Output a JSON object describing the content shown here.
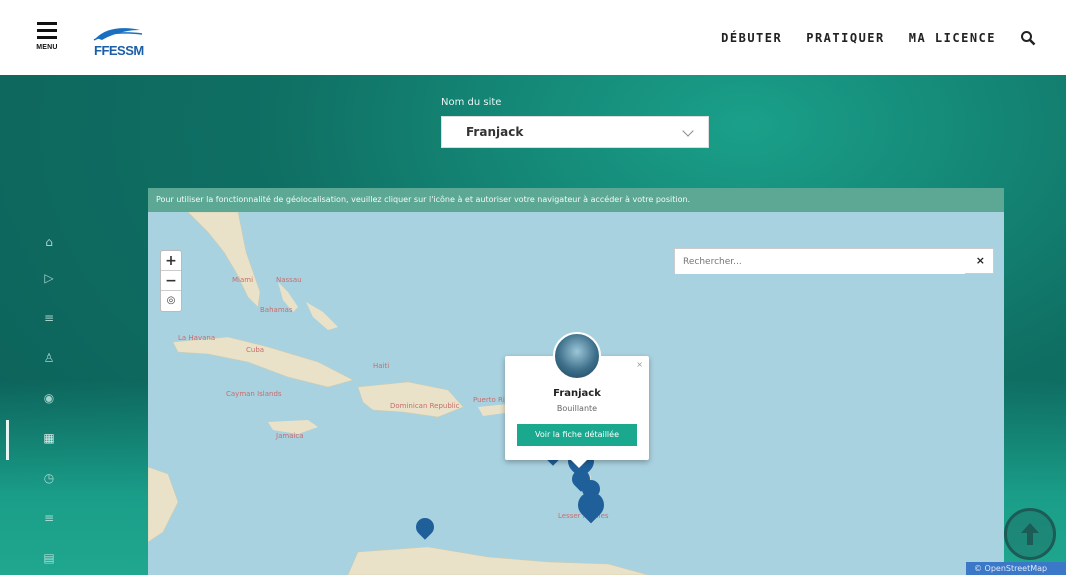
{
  "header": {
    "menu_label": "MENU",
    "logo_text": "FFESSM",
    "nav": [
      "DÉBUTER",
      "PRATIQUER",
      "MA LICENCE"
    ],
    "search_icon": "search-icon"
  },
  "site_selector": {
    "label": "Nom du site",
    "value": "Franjack"
  },
  "sidebar": {
    "icons": [
      "home-icon",
      "play-icon",
      "list-icon",
      "person-icon",
      "eye-icon",
      "map-icon",
      "clock-icon",
      "menu-icon",
      "grid-icon"
    ]
  },
  "map": {
    "geo_message": "Pour utiliser la fonctionnalité de géolocalisation, veuillez cliquer sur l'icône à et autoriser votre navigateur à accéder à votre position.",
    "search_placeholder": "Rechercher...",
    "search_clear": "×",
    "zoom": {
      "in": "+",
      "out": "−",
      "locate": "◎"
    },
    "places": [
      "Miami",
      "Nassau",
      "Bahamas",
      "La Havana",
      "Cuba",
      "Cayman Islands",
      "Jamaica",
      "Haiti",
      "Dominican Republic",
      "Puerto Rico",
      "Lesser Antilles"
    ],
    "popup": {
      "name": "Franjack",
      "location": "Bouillante",
      "button": "Voir la fiche détaillée",
      "close": "×"
    }
  },
  "footer": {
    "badge_text": "© OpenStreetMap"
  }
}
